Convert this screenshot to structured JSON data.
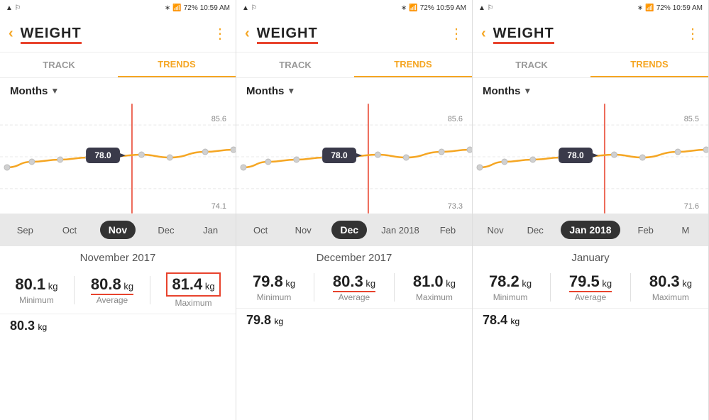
{
  "panels": [
    {
      "id": "panel1",
      "status": {
        "left": "▲ ▲",
        "battery": "72%",
        "time": "10:59 AM",
        "signal": "4G"
      },
      "title": "WEIGHT",
      "tabs": [
        "TRACK",
        "TRENDS"
      ],
      "active_tab": "TRENDS",
      "months_label": "Months",
      "chart": {
        "y_labels": [
          "85.6",
          "74.1"
        ],
        "tooltip_value": "78.0",
        "red_line_x_percent": 56,
        "line_points": "20,45 60,52 100,56 140,62 175,65 220,68 260,72 300,65"
      },
      "timeline": {
        "months": [
          "Sep",
          "Oct",
          "Nov",
          "Dec",
          "Jan"
        ],
        "active_month": "Nov"
      },
      "stats": {
        "period": "November 2017",
        "min_value": "80.1",
        "min_unit": "kg",
        "min_label": "Minimum",
        "avg_value": "80.8",
        "avg_unit": "kg",
        "avg_label": "Average",
        "avg_underlined": true,
        "max_value": "81.4",
        "max_unit": "kg",
        "max_label": "Maximum",
        "max_boxed": true
      },
      "bottom_value": "80.3",
      "bottom_unit": "kg"
    },
    {
      "id": "panel2",
      "status": {
        "left": "▲ ▲",
        "battery": "72%",
        "time": "10:59 AM",
        "signal": "4G"
      },
      "title": "WEIGHT",
      "tabs": [
        "TRACK",
        "TRENDS"
      ],
      "active_tab": "TRENDS",
      "months_label": "Months",
      "chart": {
        "y_labels": [
          "85.6",
          "73.3"
        ],
        "tooltip_value": "78.0",
        "red_line_x_percent": 56,
        "line_points": "20,40 60,47 100,52 140,58 175,62 220,66 260,70 300,62"
      },
      "timeline": {
        "months": [
          "Oct",
          "Nov",
          "Dec",
          "Jan 2018",
          "Feb"
        ],
        "active_month": "Dec"
      },
      "stats": {
        "period": "December 2017",
        "min_value": "79.8",
        "min_unit": "kg",
        "min_label": "Minimum",
        "avg_value": "80.3",
        "avg_unit": "kg",
        "avg_label": "Average",
        "avg_underlined": true,
        "max_value": "81.0",
        "max_unit": "kg",
        "max_label": "Maximum",
        "max_boxed": false
      },
      "bottom_value": "79.8",
      "bottom_unit": "kg"
    },
    {
      "id": "panel3",
      "status": {
        "left": "▲ ▲",
        "battery": "72%",
        "time": "10:59 AM",
        "signal": "4G"
      },
      "title": "WEIGHT",
      "tabs": [
        "TRACK",
        "TRENDS"
      ],
      "active_tab": "TRENDS",
      "months_label": "Months",
      "chart": {
        "y_labels": [
          "85.5",
          "71.6"
        ],
        "tooltip_value": "78.0",
        "red_line_x_percent": 56,
        "line_points": "20,38 60,44 100,50 140,55 175,59 220,63 260,67 300,60"
      },
      "timeline": {
        "months": [
          "Nov",
          "Dec",
          "Jan 2018",
          "Feb",
          "M"
        ],
        "active_month": "Jan 2018"
      },
      "stats": {
        "period": "January",
        "min_value": "78.2",
        "min_unit": "kg",
        "min_label": "Minimum",
        "avg_value": "79.5",
        "avg_unit": "kg",
        "avg_label": "Average",
        "avg_underlined": true,
        "max_value": "80.3",
        "max_unit": "kg",
        "max_label": "Maximum",
        "max_boxed": false
      },
      "bottom_value": "78.4",
      "bottom_unit": "kg"
    }
  ]
}
